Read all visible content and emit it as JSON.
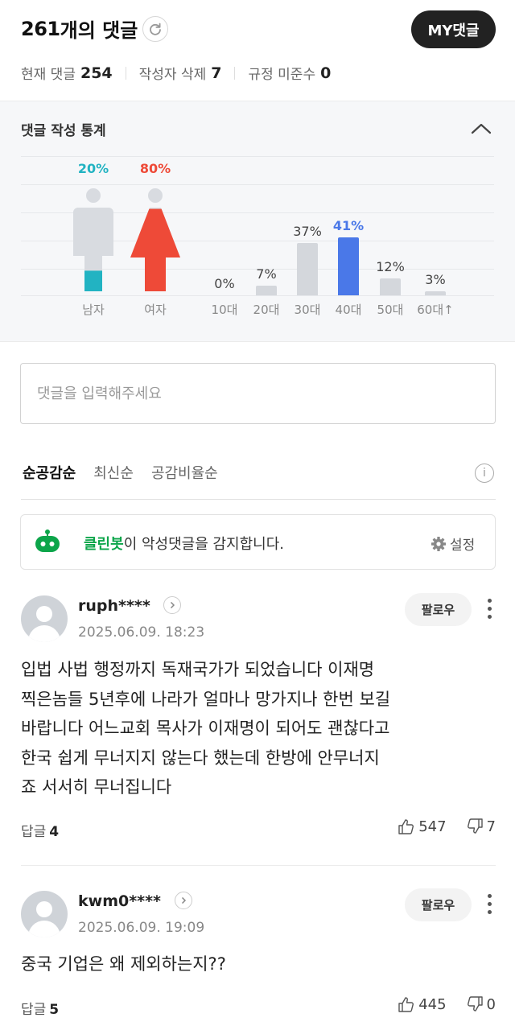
{
  "header": {
    "comment_count": "261",
    "comment_count_suffix": "개의 댓글",
    "my_button": "MY댓글",
    "stats": [
      {
        "label": "현재 댓글",
        "value": "254"
      },
      {
        "label": "작성자 삭제",
        "value": "7"
      },
      {
        "label": "규정 미준수",
        "value": "0"
      }
    ]
  },
  "stats_panel": {
    "title": "댓글 작성 통계",
    "gender": [
      {
        "label": "남자",
        "percent": "20%",
        "value": 20,
        "color": "#22b3c2"
      },
      {
        "label": "여자",
        "percent": "80%",
        "value": 80,
        "color": "#ee4a38"
      }
    ],
    "age": [
      {
        "label": "10대",
        "percent": "0%",
        "value": 0
      },
      {
        "label": "20대",
        "percent": "7%",
        "value": 7
      },
      {
        "label": "30대",
        "percent": "37%",
        "value": 37
      },
      {
        "label": "40대",
        "percent": "41%",
        "value": 41,
        "highlight": true
      },
      {
        "label": "50대",
        "percent": "12%",
        "value": 12
      },
      {
        "label": "60대↑",
        "percent": "3%",
        "value": 3
      }
    ],
    "highlight_color": "#4a78e8"
  },
  "comment_input": {
    "placeholder": "댓글을 입력해주세요"
  },
  "sort_tabs": [
    {
      "label": "순공감순",
      "active": true
    },
    {
      "label": "최신순",
      "active": false
    },
    {
      "label": "공감비율순",
      "active": false
    }
  ],
  "cleanbot": {
    "brand": "클린봇",
    "text": "이 악성댓글을 감지합니다.",
    "settings": "설정"
  },
  "comments": [
    {
      "username": "ruph****",
      "date": "2025.06.09. 18:23",
      "follow": "팔로우",
      "text": "입법 사법 행정까지 독재국가가 되었습니다 이재명\n찍은놈들 5년후에 나라가 얼마나 망가지나 한번 보길\n바랍니다 어느교회 목사가 이재명이 되어도 괜찮다고\n한국 쉽게 무너지지 않는다 했는데 한방에 안무너지\n죠 서서히 무너집니다",
      "reply_label": "답글",
      "reply_count": "4",
      "likes": "547",
      "dislikes": "7"
    },
    {
      "username": "kwm0****",
      "date": "2025.06.09. 19:09",
      "follow": "팔로우",
      "text": "중국 기업은 왜 제외하는지??",
      "reply_label": "답글",
      "reply_count": "5",
      "likes": "445",
      "dislikes": "0"
    }
  ]
}
